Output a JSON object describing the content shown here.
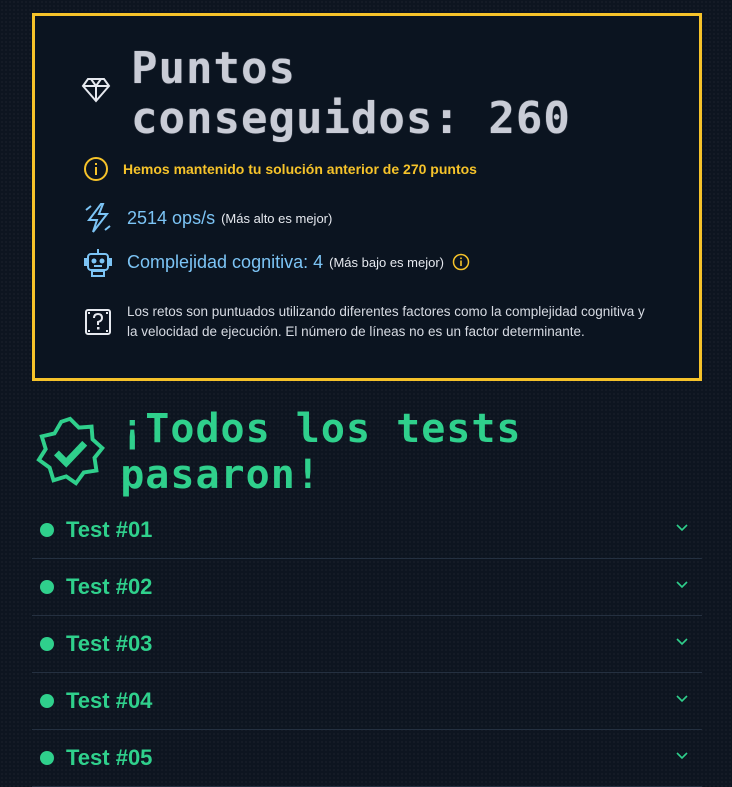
{
  "score": {
    "title": "Puntos conseguidos: 260",
    "kept_message": "Hemos mantenido tu solución anterior de 270 puntos",
    "ops_value": "2514 ops/s",
    "ops_note": "(Más alto es mejor)",
    "complexity_value": "Complejidad cognitiva: 4",
    "complexity_note": "(Más bajo es mejor)",
    "scoring_note": "Los retos son puntuados utilizando diferentes factores como la complejidad cognitiva y la velocidad de ejecución. El número de líneas no es un factor determinante."
  },
  "results": {
    "headline": "¡Todos los tests pasaron!",
    "tests": [
      {
        "label": "Test #01"
      },
      {
        "label": "Test #02"
      },
      {
        "label": "Test #03"
      },
      {
        "label": "Test #04"
      },
      {
        "label": "Test #05"
      }
    ]
  },
  "colors": {
    "accent_yellow": "#f6c32a",
    "success_green": "#2fd08c",
    "stat_blue": "#7cc4f5"
  },
  "icons": [
    "diamond-icon",
    "info-icon",
    "lightning-icon",
    "robot-icon",
    "question-box-icon",
    "check-badge-icon",
    "chevron-down-icon"
  ]
}
